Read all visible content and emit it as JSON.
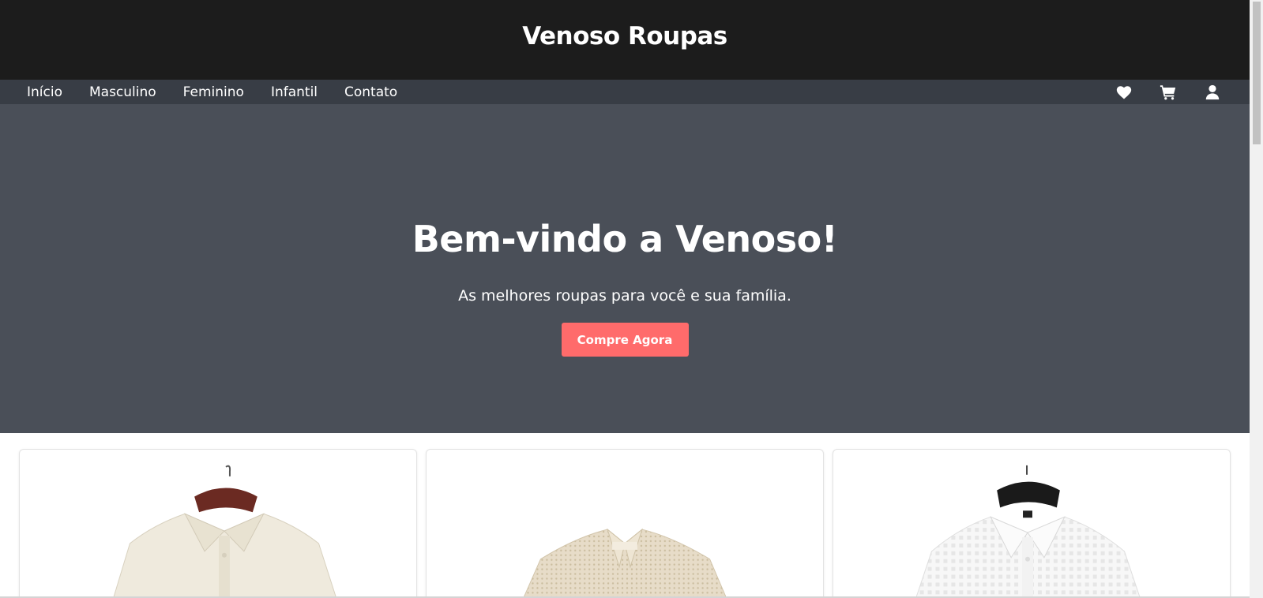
{
  "header": {
    "title": "Venoso Roupas"
  },
  "nav": {
    "links": [
      "Início",
      "Masculino",
      "Feminino",
      "Infantil",
      "Contato"
    ],
    "icons": [
      "heart-icon",
      "cart-icon",
      "user-icon"
    ]
  },
  "hero": {
    "title": "Bem-vindo a Venoso!",
    "subtitle": "As melhores roupas para você e sua família.",
    "button_label": "Compre Agora"
  },
  "colors": {
    "header_bg": "#1c1c1c",
    "nav_bg": "#383d45",
    "hero_bg": "#4a4f58",
    "button_bg": "#ff6b6b"
  },
  "products": [
    {
      "image": "cream textured knit polo shirt on brown hanger"
    },
    {
      "image": "beige open-knit crochet polo shirt"
    },
    {
      "image": "white sheer checked button-up shirt on black hanger"
    }
  ]
}
